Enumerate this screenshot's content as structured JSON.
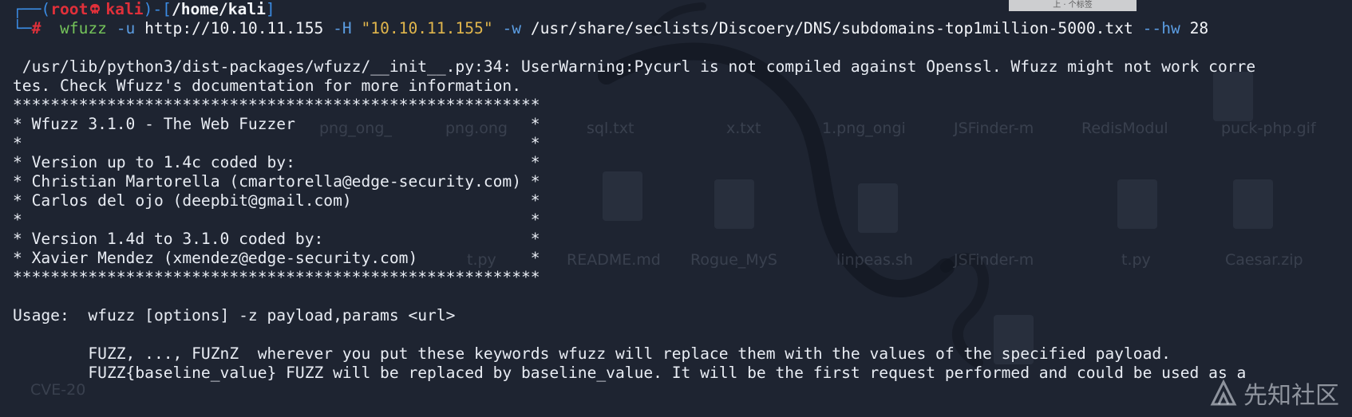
{
  "prompt": {
    "user": "root",
    "host": "kali",
    "cwd": "/home/kali",
    "symbol": "#"
  },
  "command": {
    "program": "wfuzz",
    "flag_u": "-u",
    "url": "http://10.10.11.155",
    "flag_H": "-H",
    "header": "\"10.10.11.155\"",
    "flag_w": "-w",
    "wordlist": "/usr/share/seclists/Discoery/DNS/subdomains-top1million-5000.txt",
    "flag_hw": "--hw",
    "hw_value": "28"
  },
  "output": {
    "warning_1": " /usr/lib/python3/dist-packages/wfuzz/__init__.py:34: UserWarning:Pycurl is not compiled against Openssl. Wfuzz might not work corre",
    "warning_2": "tes. Check Wfuzz's documentation for more information.",
    "banner": [
      "********************************************************",
      "* Wfuzz 3.1.0 - The Web Fuzzer                         *",
      "*                                                      *",
      "* Version up to 1.4c coded by:                         *",
      "* Christian Martorella (cmartorella@edge-security.com) *",
      "* Carlos del ojo (deepbit@gmail.com)                   *",
      "*                                                      *",
      "* Version 1.4d to 3.1.0 coded by:                      *",
      "* Xavier Mendez (xmendez@edge-security.com)            *",
      "********************************************************"
    ],
    "usage": "Usage:  wfuzz [options] -z payload,params <url>",
    "fuzz_1": "        FUZZ, ..., FUZnZ  wherever you put these keywords wfuzz will replace them with the values of the specified payload.",
    "fuzz_2": "        FUZZ{baseline_value} FUZZ will be replaced by baseline_value. It will be the first request performed and could be used as a"
  },
  "background_desktop": {
    "row_1": [
      "png_ong_",
      "png.ong",
      "sql.txt",
      "x.txt",
      "1.png_ongi",
      "JSFinder-m",
      "RedisModul",
      "puck-php.gif"
    ],
    "row_2": [
      "t.py",
      "README.md",
      "Rogue_MyS",
      "linpeas.sh",
      "JSFinder-m",
      "t.py",
      "Caesar.zip"
    ],
    "row_3": [
      "CVE-20"
    ]
  },
  "top_overlay_text": "上 · 个标签",
  "watermark": "先知社区",
  "colors": {
    "background": "#1e2431",
    "prompt_frame": "#3b8ce4",
    "prompt_user": "#e0303a",
    "command": "#74c35a",
    "flag": "#5b9de2",
    "string": "#e1b64c",
    "text": "#e9edf4"
  }
}
